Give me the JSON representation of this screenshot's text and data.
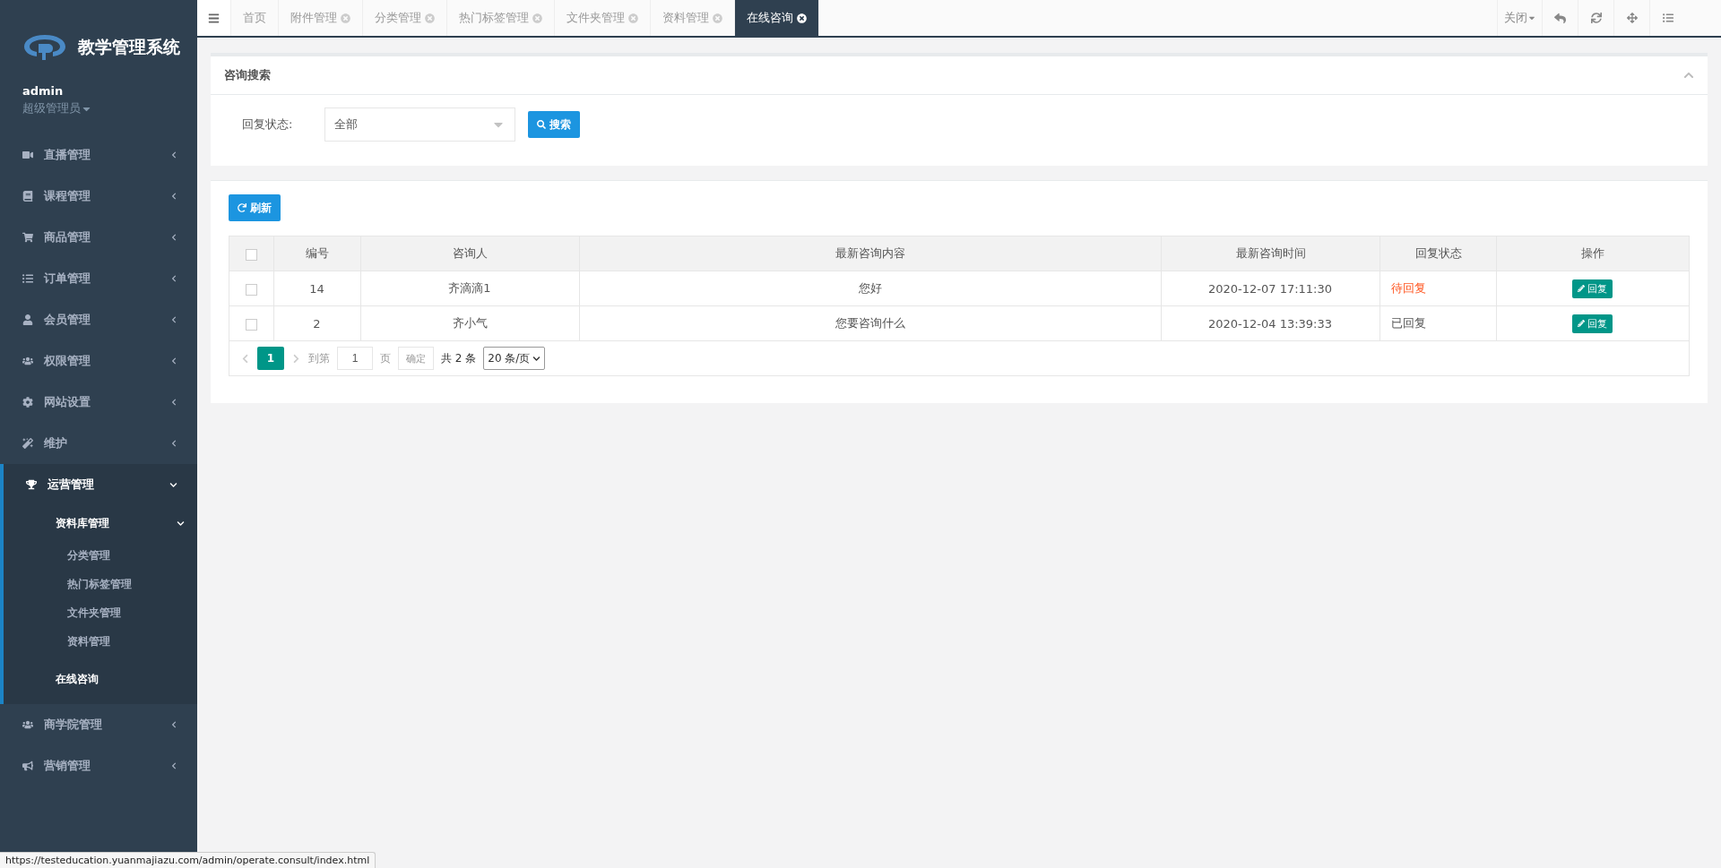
{
  "sidebar": {
    "logo_title": "教学管理系统",
    "user": {
      "name": "admin",
      "role": "超级管理员"
    },
    "menu": [
      {
        "label": "直播管理",
        "expanded": false
      },
      {
        "label": "课程管理",
        "expanded": false
      },
      {
        "label": "商品管理",
        "expanded": false
      },
      {
        "label": "订单管理",
        "expanded": false
      },
      {
        "label": "会员管理",
        "expanded": false
      },
      {
        "label": "权限管理",
        "expanded": false
      },
      {
        "label": "网站设置",
        "expanded": false
      },
      {
        "label": "维护",
        "expanded": false
      },
      {
        "label": "运营管理",
        "expanded": true,
        "children": [
          {
            "label": "资料库管理",
            "expanded": true,
            "children": [
              {
                "label": "分类管理",
                "selected": false
              },
              {
                "label": "热门标签管理",
                "selected": false
              },
              {
                "label": "文件夹管理",
                "selected": false
              },
              {
                "label": "资料管理",
                "selected": false
              }
            ]
          },
          {
            "label": "在线咨询",
            "selected": true
          }
        ]
      },
      {
        "label": "商学院管理",
        "expanded": false
      },
      {
        "label": "营销管理",
        "expanded": false
      }
    ]
  },
  "tabs": [
    {
      "label": "首页",
      "selected": false,
      "closable": false
    },
    {
      "label": "附件管理",
      "selected": false,
      "closable": true
    },
    {
      "label": "分类管理",
      "selected": false,
      "closable": true
    },
    {
      "label": "热门标签管理",
      "selected": false,
      "closable": true
    },
    {
      "label": "文件夹管理",
      "selected": false,
      "closable": true
    },
    {
      "label": "资料管理",
      "selected": false,
      "closable": true
    },
    {
      "label": "在线咨询",
      "selected": true,
      "closable": true
    }
  ],
  "tab_tools": {
    "close_menu": "关闭"
  },
  "search_panel": {
    "title": "咨询搜索",
    "field_label": "回复状态:",
    "select_value": "全部",
    "search_button": "搜索"
  },
  "list_panel": {
    "refresh_button": "刷新",
    "table": {
      "header_checked": false,
      "columns": [
        "编号",
        "咨询人",
        "最新咨询内容",
        "最新咨询时间",
        "回复状态",
        "操作"
      ],
      "rows": [
        {
          "checked": false,
          "id": "14",
          "name": "齐滴滴1",
          "content": "您好",
          "time": "2020-12-07 17:11:30",
          "status": "待回复",
          "pending": true,
          "action": "回复"
        },
        {
          "checked": false,
          "id": "2",
          "name": "齐小气",
          "content": "您要咨询什么",
          "time": "2020-12-04 13:39:33",
          "status": "已回复",
          "pending": false,
          "action": "回复"
        }
      ]
    },
    "pagination": {
      "pages": [
        {
          "label": "1",
          "selected": true
        }
      ],
      "goto_label": "到第",
      "goto_value": "1",
      "page_unit": "页",
      "confirm": "确定",
      "total": "共 2 条",
      "page_size": "20 条/页"
    }
  },
  "status_bar": {
    "url": "https://testeducation.yuanmajiazu.com/admin/operate.consult/index.html"
  }
}
